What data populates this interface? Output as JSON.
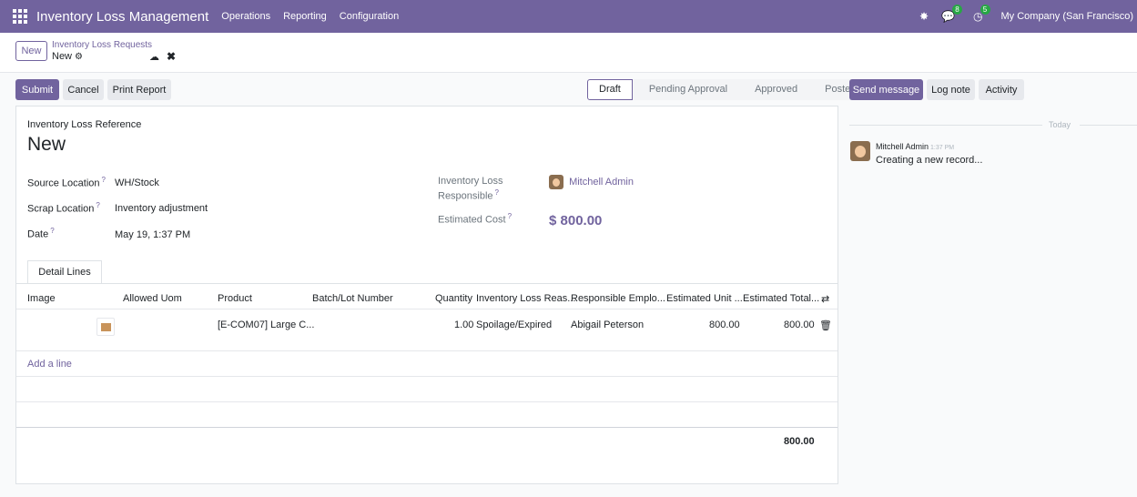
{
  "navbar": {
    "app_name": "Inventory Loss Management",
    "menu": [
      "Operations",
      "Reporting",
      "Configuration"
    ],
    "messages_count": "8",
    "activities_count": "5",
    "company": "My Company (San Francisco)"
  },
  "control_panel": {
    "new_label": "New",
    "breadcrumb_parent": "Inventory Loss Requests",
    "breadcrumb_current": "New"
  },
  "actions": {
    "submit": "Submit",
    "cancel": "Cancel",
    "print": "Print Report"
  },
  "status_stages": [
    "Draft",
    "Pending Approval",
    "Approved",
    "Posted"
  ],
  "status_active": "Draft",
  "form": {
    "reference_label": "Inventory Loss Reference",
    "reference_value": "New",
    "source_location_label": "Source Location",
    "source_location_value": "WH/Stock",
    "scrap_location_label": "Scrap Location",
    "scrap_location_value": "Inventory adjustment",
    "date_label": "Date",
    "date_value": "May 19, 1:37 PM",
    "responsible_label_1": "Inventory Loss",
    "responsible_label_2": "Responsible",
    "responsible_value": "Mitchell Admin",
    "estimated_cost_label": "Estimated Cost",
    "estimated_cost_value": "$ 800.00"
  },
  "tabs": [
    "Detail Lines"
  ],
  "table": {
    "headers": [
      "Image",
      "Allowed Uom",
      "Product",
      "Batch/Lot Number",
      "Quantity",
      "Inventory Loss Reas...",
      "Responsible Emplo...",
      "Estimated Unit ...",
      "Estimated Total..."
    ],
    "row": {
      "product": "[E-COM07] Large C...",
      "quantity": "1.00",
      "reason": "Spoilage/Expired",
      "employee": "Abigail Peterson",
      "unit_cost": "800.00",
      "total_cost": "800.00"
    },
    "add_line": "Add a line",
    "footer_total": "800.00"
  },
  "chatter": {
    "send_message": "Send message",
    "log_note": "Log note",
    "activity": "Activity",
    "today": "Today",
    "message_author": "Mitchell Admin",
    "message_time": "1:37 PM",
    "message_body": "Creating a new record..."
  }
}
